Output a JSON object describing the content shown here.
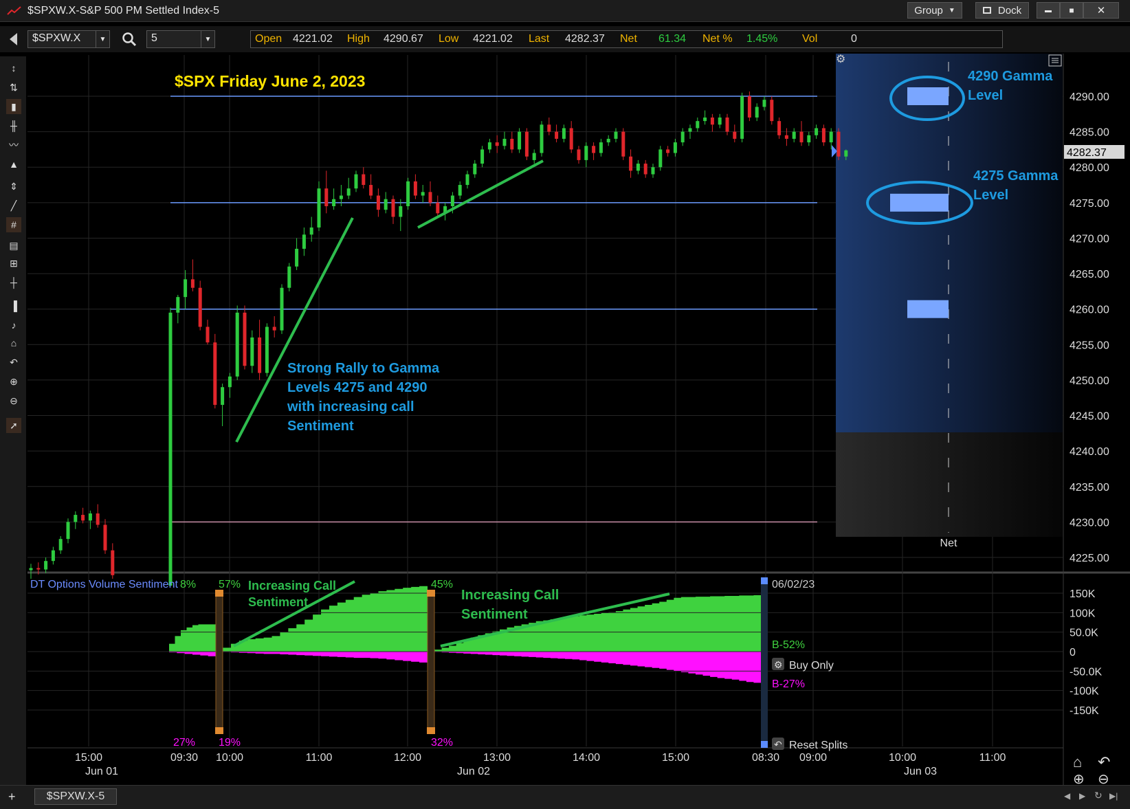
{
  "window": {
    "title": "$SPXW.X-S&P 500 PM Settled Index-5",
    "group_label": "Group",
    "dock_label": "Dock",
    "minimize": "▬",
    "maximize": "■",
    "close": "✕"
  },
  "toolbar": {
    "symbol": "$SPXW.X",
    "interval": "5",
    "quote": [
      {
        "label": "Open",
        "value": "4221.02"
      },
      {
        "label": "High",
        "value": "4290.67"
      },
      {
        "label": "Low",
        "value": "4221.02"
      },
      {
        "label": "Last",
        "value": "4282.37"
      },
      {
        "label": "Net",
        "value": "61.34"
      },
      {
        "label": "Net %",
        "value": "1.45%"
      },
      {
        "label": "Vol",
        "value": "0"
      }
    ]
  },
  "colors": {
    "up": "#2ecc40",
    "down": "#e0262b",
    "gamma_line": "#6b9bff",
    "sentiment_call": "#3fd23f",
    "sentiment_put": "#ff10ff",
    "annotation_blue": "#1e9be0",
    "annotation_green": "#2ebd4e",
    "title_yellow": "#ffe400"
  },
  "chart_data": [
    {
      "type": "candlestick",
      "title": "$SPX Friday June 2, 2023",
      "y_axis_ticks": [
        "4290.00",
        "4285.00",
        "4280.00",
        "4275.00",
        "4270.00",
        "4265.00",
        "4260.00",
        "4255.00",
        "4250.00",
        "4245.00",
        "4240.00",
        "4235.00",
        "4230.00",
        "4225.00"
      ],
      "ylim": [
        4222,
        4293
      ],
      "last_price_label": "4282.37",
      "x_axis_ticks": [
        "15:00",
        "09:30",
        "10:00",
        "11:00",
        "12:00",
        "13:00",
        "14:00",
        "15:00",
        "08:30",
        "09:00",
        "10:00",
        "11:00"
      ],
      "x_axis_dates": [
        "Jun 01",
        "Jun 02",
        "Jun 03"
      ],
      "horizontal_levels": [
        4290,
        4275,
        4260,
        4230
      ],
      "gamma_panel": {
        "footer_label": "Net",
        "bars": [
          {
            "level": 4290,
            "value": 0.6
          },
          {
            "level": 4275,
            "value": 0.85
          },
          {
            "level": 4260,
            "value": 0.6
          }
        ]
      },
      "annotations": [
        {
          "text": "4290 Gamma Level",
          "lines": [
            "4290 Gamma",
            "Level"
          ]
        },
        {
          "text": "4275 Gamma Level",
          "lines": [
            "4275 Gamma",
            "Level"
          ]
        },
        {
          "text": "Strong Rally to Gamma Levels 4275 and 4290 with increasing call Sentiment",
          "lines": [
            "Strong Rally to Gamma",
            "Levels 4275 and 4290",
            "with increasing call",
            "Sentiment"
          ]
        }
      ],
      "candles_jun01": [
        [
          4223.2,
          4224.1,
          4222.0,
          4223.5
        ],
        [
          4223.5,
          4224.3,
          4222.6,
          4223.3
        ],
        [
          4223.3,
          4225.0,
          4222.8,
          4224.5
        ],
        [
          4224.5,
          4226.5,
          4224.0,
          4226.0
        ],
        [
          4226.0,
          4228.0,
          4225.5,
          4227.6
        ],
        [
          4227.6,
          4230.5,
          4227.0,
          4230.0
        ],
        [
          4230.0,
          4231.5,
          4229.0,
          4231.0
        ],
        [
          4231.0,
          4232.0,
          4229.8,
          4230.2
        ],
        [
          4230.2,
          4231.6,
          4229.0,
          4231.2
        ],
        [
          4231.2,
          4232.5,
          4229.2,
          4229.6
        ],
        [
          4229.6,
          4230.4,
          4225.5,
          4226.0
        ],
        [
          4226.0,
          4227.0,
          4222.0,
          4222.5
        ]
      ],
      "candles_jun02": [
        [
          4221.02,
          4260.2,
          4221.02,
          4259.5
        ],
        [
          4259.5,
          4262.0,
          4258.0,
          4261.7
        ],
        [
          4261.7,
          4265.5,
          4260.0,
          4264.2
        ],
        [
          4264.2,
          4267.0,
          4262.5,
          4263.0
        ],
        [
          4263.0,
          4264.0,
          4257.0,
          4257.5
        ],
        [
          4257.5,
          4258.5,
          4255.0,
          4255.3
        ],
        [
          4255.3,
          4256.5,
          4246.0,
          4246.5
        ],
        [
          4246.5,
          4249.5,
          4243.5,
          4249.0
        ],
        [
          4249.0,
          4251.0,
          4247.5,
          4250.5
        ],
        [
          4250.5,
          4260.5,
          4250.0,
          4259.5
        ],
        [
          4259.5,
          4260.5,
          4251.5,
          4252.0
        ],
        [
          4252.0,
          4257.0,
          4251.0,
          4256.0
        ],
        [
          4256.0,
          4258.5,
          4250.0,
          4251.0
        ],
        [
          4251.0,
          4258.0,
          4250.5,
          4257.5
        ],
        [
          4257.5,
          4259.0,
          4256.0,
          4257.0
        ],
        [
          4257.0,
          4263.5,
          4256.5,
          4263.0
        ],
        [
          4263.0,
          4266.5,
          4262.5,
          4266.0
        ],
        [
          4266.0,
          4270.0,
          4265.5,
          4268.5
        ],
        [
          4268.5,
          4271.5,
          4267.5,
          4270.5
        ],
        [
          4270.5,
          4273.0,
          4269.5,
          4271.5
        ],
        [
          4271.5,
          4278.0,
          4271.0,
          4277.0
        ],
        [
          4277.0,
          4279.5,
          4273.5,
          4274.5
        ],
        [
          4274.5,
          4277.0,
          4274.0,
          4275.5
        ],
        [
          4275.5,
          4277.5,
          4274.5,
          4276.0
        ],
        [
          4276.0,
          4278.5,
          4275.5,
          4277.0
        ],
        [
          4277.0,
          4279.5,
          4276.5,
          4279.0
        ],
        [
          4279.0,
          4280.0,
          4277.0,
          4277.5
        ],
        [
          4277.5,
          4279.0,
          4275.5,
          4276.0
        ],
        [
          4276.0,
          4277.0,
          4273.0,
          4274.0
        ],
        [
          4274.0,
          4276.5,
          4273.5,
          4275.5
        ],
        [
          4275.5,
          4276.0,
          4272.0,
          4273.0
        ],
        [
          4273.0,
          4275.5,
          4271.0,
          4274.5
        ],
        [
          4274.5,
          4278.5,
          4274.0,
          4278.0
        ],
        [
          4278.0,
          4279.0,
          4275.5,
          4276.0
        ],
        [
          4276.0,
          4277.5,
          4275.0,
          4276.5
        ],
        [
          4276.5,
          4278.0,
          4274.5,
          4275.0
        ],
        [
          4275.0,
          4276.0,
          4273.0,
          4273.5
        ],
        [
          4273.5,
          4275.0,
          4272.5,
          4274.5
        ],
        [
          4274.5,
          4276.5,
          4273.5,
          4276.0
        ],
        [
          4276.0,
          4278.0,
          4275.5,
          4277.5
        ],
        [
          4277.5,
          4279.5,
          4277.0,
          4279.0
        ],
        [
          4279.0,
          4281.0,
          4278.5,
          4280.5
        ],
        [
          4280.5,
          4283.0,
          4280.0,
          4282.5
        ],
        [
          4282.5,
          4284.0,
          4282.0,
          4283.5
        ],
        [
          4283.5,
          4284.5,
          4282.0,
          4283.0
        ],
        [
          4283.0,
          4285.0,
          4282.5,
          4284.0
        ],
        [
          4284.0,
          4285.0,
          4282.0,
          4282.5
        ],
        [
          4282.5,
          4285.5,
          4282.0,
          4285.0
        ],
        [
          4285.0,
          4285.5,
          4281.0,
          4281.5
        ],
        [
          4281.0,
          4282.5,
          4280.5,
          4282.0
        ],
        [
          4282.0,
          4286.5,
          4281.5,
          4286.0
        ],
        [
          4286.0,
          4287.0,
          4284.5,
          4285.0
        ],
        [
          4285.0,
          4286.0,
          4283.5,
          4284.0
        ],
        [
          4284.0,
          4286.0,
          4283.5,
          4285.5
        ],
        [
          4285.5,
          4286.5,
          4282.0,
          4282.5
        ],
        [
          4282.5,
          4283.0,
          4280.5,
          4281.0
        ],
        [
          4281.0,
          4283.5,
          4280.0,
          4283.0
        ],
        [
          4283.0,
          4283.5,
          4281.0,
          4282.0
        ],
        [
          4282.0,
          4284.0,
          4281.5,
          4283.5
        ],
        [
          4283.5,
          4284.5,
          4283.0,
          4284.0
        ],
        [
          4284.0,
          4285.5,
          4283.5,
          4285.0
        ],
        [
          4285.0,
          4285.5,
          4281.0,
          4281.5
        ],
        [
          4281.5,
          4282.5,
          4278.5,
          4279.5
        ],
        [
          4279.5,
          4281.0,
          4279.0,
          4280.5
        ],
        [
          4280.5,
          4281.0,
          4278.5,
          4279.0
        ],
        [
          4279.0,
          4280.5,
          4278.5,
          4280.0
        ],
        [
          4280.0,
          4283.0,
          4279.5,
          4282.5
        ],
        [
          4282.5,
          4283.0,
          4281.5,
          4282.0
        ],
        [
          4282.0,
          4284.0,
          4281.5,
          4283.5
        ],
        [
          4283.5,
          4285.5,
          4283.0,
          4285.0
        ],
        [
          4285.0,
          4286.0,
          4284.0,
          4285.5
        ],
        [
          4285.5,
          4287.0,
          4285.0,
          4286.5
        ],
        [
          4286.5,
          4288.0,
          4286.0,
          4287.0
        ],
        [
          4287.0,
          4287.5,
          4285.0,
          4286.0
        ],
        [
          4286.0,
          4287.5,
          4285.5,
          4287.0
        ],
        [
          4287.0,
          4287.5,
          4284.5,
          4285.0
        ],
        [
          4285.0,
          4286.0,
          4283.5,
          4284.0
        ],
        [
          4284.0,
          4290.5,
          4283.5,
          4290.0
        ],
        [
          4290.0,
          4290.67,
          4286.5,
          4287.0
        ],
        [
          4287.0,
          4289.0,
          4286.5,
          4288.5
        ],
        [
          4288.5,
          4290.0,
          4288.0,
          4289.5
        ],
        [
          4289.5,
          4290.0,
          4286.0,
          4286.5
        ],
        [
          4286.5,
          4287.0,
          4284.0,
          4284.5
        ],
        [
          4284.5,
          4285.5,
          4283.0,
          4284.0
        ],
        [
          4284.0,
          4285.5,
          4283.5,
          4285.0
        ],
        [
          4285.0,
          4286.5,
          4283.0,
          4283.5
        ],
        [
          4283.5,
          4285.0,
          4283.0,
          4284.5
        ],
        [
          4284.5,
          4286.0,
          4284.0,
          4285.5
        ],
        [
          4285.5,
          4286.0,
          4283.0,
          4283.5
        ],
        [
          4283.5,
          4285.5,
          4282.5,
          4285.0
        ],
        [
          4285.0,
          4285.5,
          4281.0,
          4281.5
        ],
        [
          4281.5,
          4282.5,
          4281.0,
          4282.37
        ]
      ]
    },
    {
      "type": "area",
      "title": "DT Options Volume Sentiment",
      "title_suffix": "8%",
      "y_axis_ticks": [
        "150K",
        "100K",
        "50.0K",
        "0",
        "-50.0K",
        "-100K",
        "-150K"
      ],
      "ylim": [
        -170000,
        175000
      ],
      "labels": {
        "date": "06/02/23",
        "pct_top_1": "57%",
        "pct_top_2": "45%",
        "pct_bottom_0": "27%",
        "pct_bottom_1": "19%",
        "pct_bottom_2": "32%",
        "call_label": "B-52%",
        "put_label": "B-27%",
        "buy_only": "Buy Only",
        "reset_splits": "Reset Splits"
      },
      "annotations": [
        {
          "text": "Increasing Call Sentiment",
          "lines": [
            "Increasing Call",
            "Sentiment"
          ]
        },
        {
          "text": "Increasing Call Sentiment",
          "lines": [
            "Increasing Call",
            "Sentiment"
          ]
        }
      ],
      "segments": [
        {
          "calls": [
            20000,
            40000,
            55000,
            62000,
            68000,
            70000,
            70000,
            70000
          ],
          "puts": [
            -2000,
            -4000,
            -6000,
            -8000,
            -10000,
            -12000
          ]
        },
        {
          "calls": [
            10000,
            20000,
            28000,
            32000,
            34000,
            36000,
            40000,
            50000,
            60000,
            70000,
            82000,
            95000,
            108000,
            118000,
            126000,
            133000,
            140000,
            146000,
            150000,
            155000,
            158000,
            161000,
            164000,
            166000,
            168000
          ],
          "puts": [
            -1000,
            -2000,
            -3000,
            -4000,
            -5000,
            -6000,
            -6000,
            -7000,
            -8000,
            -9000,
            -10000,
            -11000,
            -12000,
            -13000,
            -14000,
            -15000,
            -16000,
            -16000,
            -17000,
            -18000,
            -20000,
            -22000,
            -24000,
            -26000,
            -28000
          ]
        },
        {
          "calls": [
            5000,
            10000,
            15000,
            22000,
            30000,
            36000,
            42000,
            47000,
            52000,
            57000,
            62000,
            66000,
            70000,
            74000,
            78000,
            80000,
            83000,
            86000,
            88000,
            91000,
            93000,
            95000,
            97000,
            99000,
            101000,
            104000,
            108000,
            112000,
            116000,
            120000,
            124000,
            128000,
            133000,
            138000,
            140000,
            140000,
            141000,
            141000,
            142000,
            142000,
            143000,
            143000,
            144000,
            144000,
            145000
          ],
          "puts": [
            -1000,
            -2000,
            -3000,
            -4000,
            -5000,
            -6000,
            -7000,
            -8000,
            -9000,
            -10000,
            -11000,
            -12000,
            -13000,
            -14000,
            -15000,
            -16000,
            -17000,
            -18000,
            -19000,
            -20000,
            -22000,
            -24000,
            -26000,
            -28000,
            -30000,
            -32000,
            -34000,
            -36000,
            -38000,
            -40000,
            -42000,
            -44000,
            -47000,
            -50000,
            -53000,
            -56000,
            -59000,
            -62000,
            -65000,
            -68000,
            -70000,
            -72000,
            -75000,
            -78000,
            -80000
          ]
        }
      ]
    }
  ],
  "bottom": {
    "tab_label": "$SPXW.X-5"
  }
}
